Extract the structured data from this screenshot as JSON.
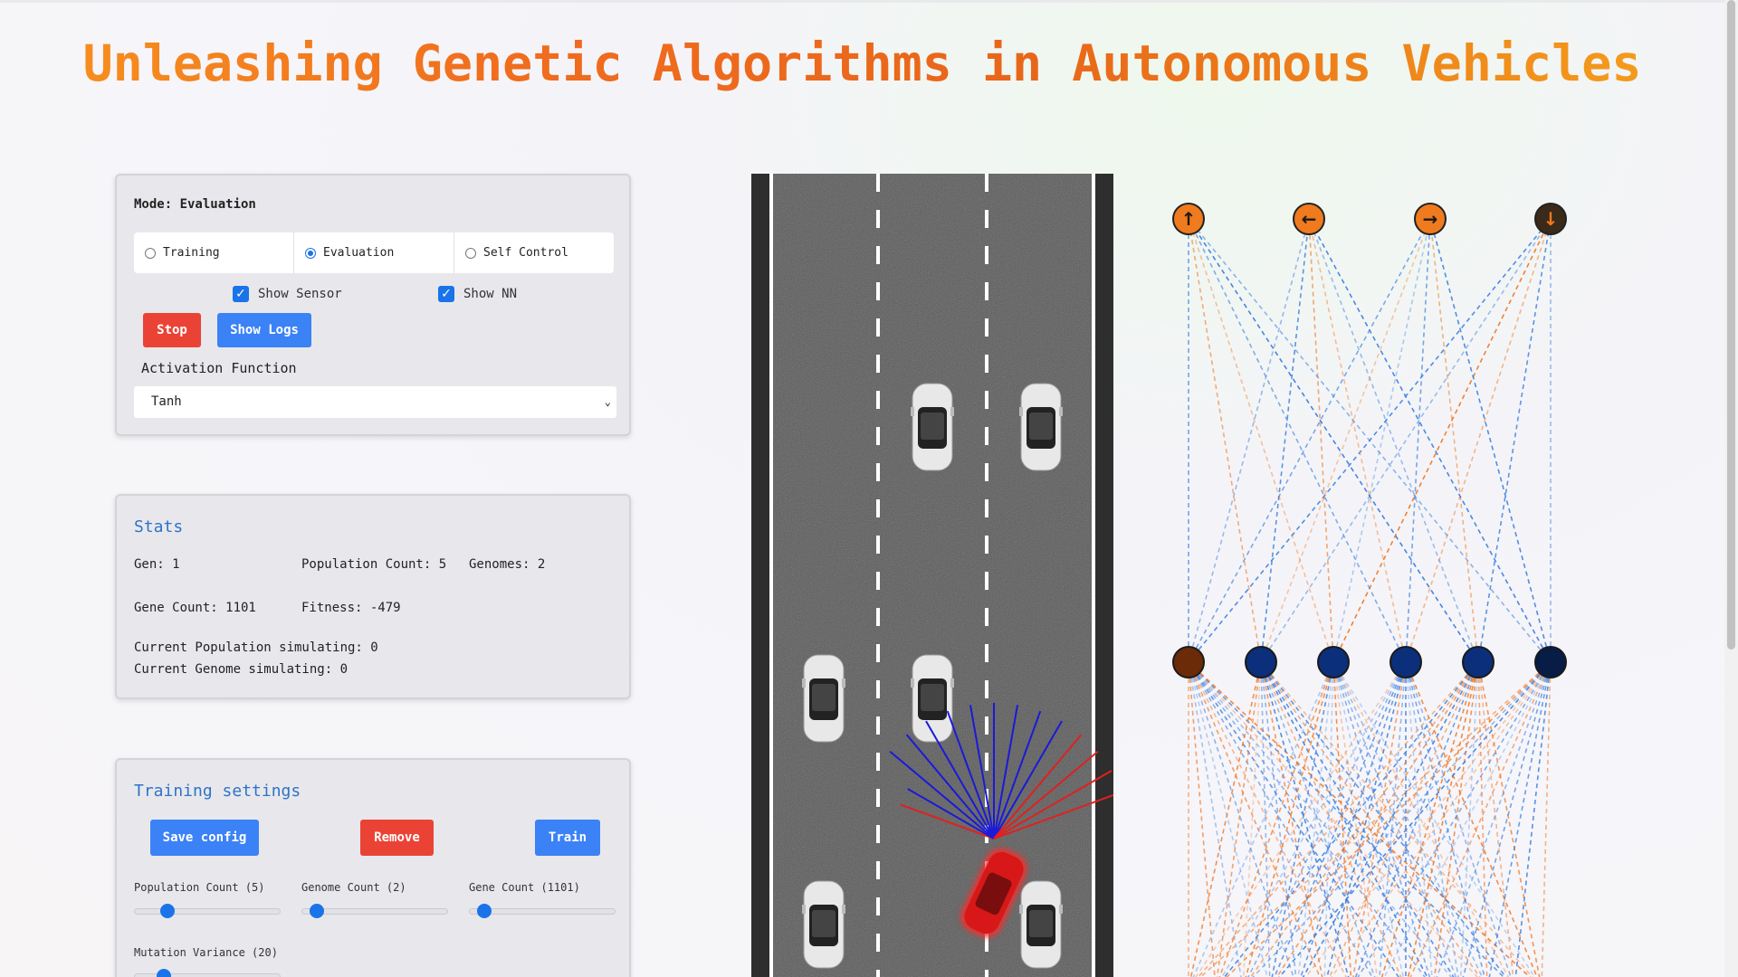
{
  "title": "Unleashing Genetic Algorithms in Autonomous Vehicles",
  "mode_panel": {
    "mode_label": "Mode: Evaluation",
    "radios": [
      {
        "label": "Training",
        "selected": false
      },
      {
        "label": "Evaluation",
        "selected": true
      },
      {
        "label": "Self Control",
        "selected": false
      }
    ],
    "show_sensor": "Show Sensor",
    "show_nn": "Show NN",
    "stop_label": "Stop",
    "show_logs_label": "Show Logs",
    "activation_label": "Activation Function",
    "activation_value": "Tanh"
  },
  "stats": {
    "title": "Stats",
    "gen": "Gen: 1",
    "population_count": "Population Count: 5",
    "genomes": "Genomes: 2",
    "gene_count": "Gene Count: 1101",
    "fitness": "Fitness: -479",
    "current_population": "Current Population simulating: 0",
    "current_genome": "Current Genome simulating: 0"
  },
  "training": {
    "title": "Training settings",
    "save_label": "Save config",
    "remove_label": "Remove",
    "train_label": "Train",
    "sliders": [
      {
        "label": "Population Count (5)",
        "level": 0.22
      },
      {
        "label": "Genome Count (2)",
        "level": 0.1
      },
      {
        "label": "Gene Count (1101)",
        "level": 0.1
      },
      {
        "label": "Mutation Variance (20)",
        "level": 0.2
      }
    ]
  },
  "nn": {
    "output_icons": [
      "arrow-up-icon",
      "arrow-left-icon",
      "arrow-right-icon",
      "arrow-down-icon"
    ],
    "colors": {
      "positive": "#f07a2a",
      "negative": "#3a7fe0",
      "node_dark": "#0b2f7a",
      "node_brown": "#6b2a08",
      "output": "#f07a1e"
    }
  },
  "colors": {
    "accent": "#1a73e8",
    "danger": "#ea4335",
    "button": "#3b82f6",
    "title_orange": "#f0781e",
    "section_blue": "#2f73c7"
  }
}
